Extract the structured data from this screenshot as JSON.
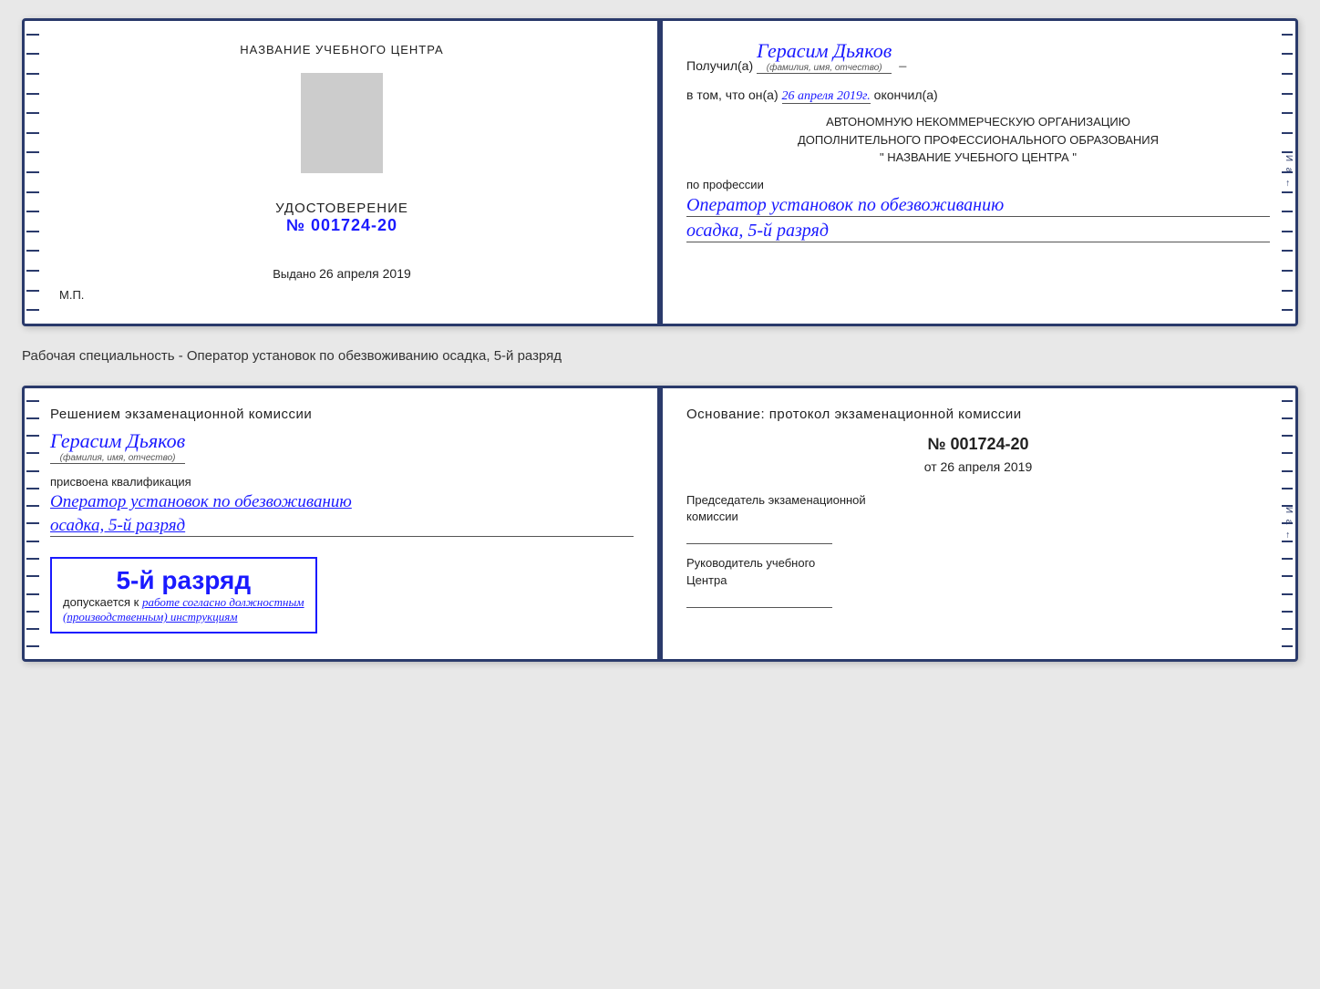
{
  "top_card": {
    "left": {
      "org_name": "НАЗВАНИЕ УЧЕБНОГО ЦЕНТРА",
      "cert_title": "УДОСТОВЕРЕНИЕ",
      "cert_number_prefix": "№",
      "cert_number": "001724-20",
      "issued_prefix": "Выдано",
      "issued_date": "26 апреля 2019",
      "stamp": "М.П."
    },
    "right": {
      "recipient_prefix": "Получил(а)",
      "recipient_name": "Герасим Дьяков",
      "name_subtitle": "(фамилия, имя, отчество)",
      "dash": "–",
      "date_prefix": "в том, что он(а)",
      "date_value": "26 апреля 2019г.",
      "date_suffix": "окончил(а)",
      "org_line1": "АВТОНОМНУЮ НЕКОММЕРЧЕСКУЮ ОРГАНИЗАЦИЮ",
      "org_line2": "ДОПОЛНИТЕЛЬНОГО ПРОФЕССИОНАЛЬНОГО ОБРАЗОВАНИЯ",
      "org_line3": "\"  НАЗВАНИЕ УЧЕБНОГО ЦЕНТРА  \"",
      "profession_label": "по профессии",
      "profession_value": "Оператор установок по обезвоживанию",
      "profession_value2": "осадка, 5-й разряд"
    }
  },
  "middle_label": "Рабочая специальность - Оператор установок по обезвоживанию осадка, 5-й разряд",
  "bottom_card": {
    "left": {
      "decision_text": "Решением экзаменационной комиссии",
      "person_name": "Герасим Дьяков",
      "name_subtitle": "(фамилия, имя, отчество)",
      "qualification_prefix": "присвоена квалификация",
      "qualification_value": "Оператор установок по обезвоживанию",
      "qualification_value2": "осадка, 5-й разряд",
      "rank_title": "5-й разряд",
      "rank_admit": "допускается к",
      "rank_work": "работе согласно должностным",
      "rank_instruction": "(производственным) инструкциям"
    },
    "right": {
      "basis_title": "Основание: протокол экзаменационной комиссии",
      "protocol_number": "№  001724-20",
      "protocol_date_prefix": "от",
      "protocol_date": "26 апреля 2019",
      "chairman_label": "Председатель экзаменационной",
      "chairman_label2": "комиссии",
      "director_label": "Руководитель учебного",
      "director_label2": "Центра"
    }
  },
  "deco": {
    "letters_right": "И а ←"
  }
}
